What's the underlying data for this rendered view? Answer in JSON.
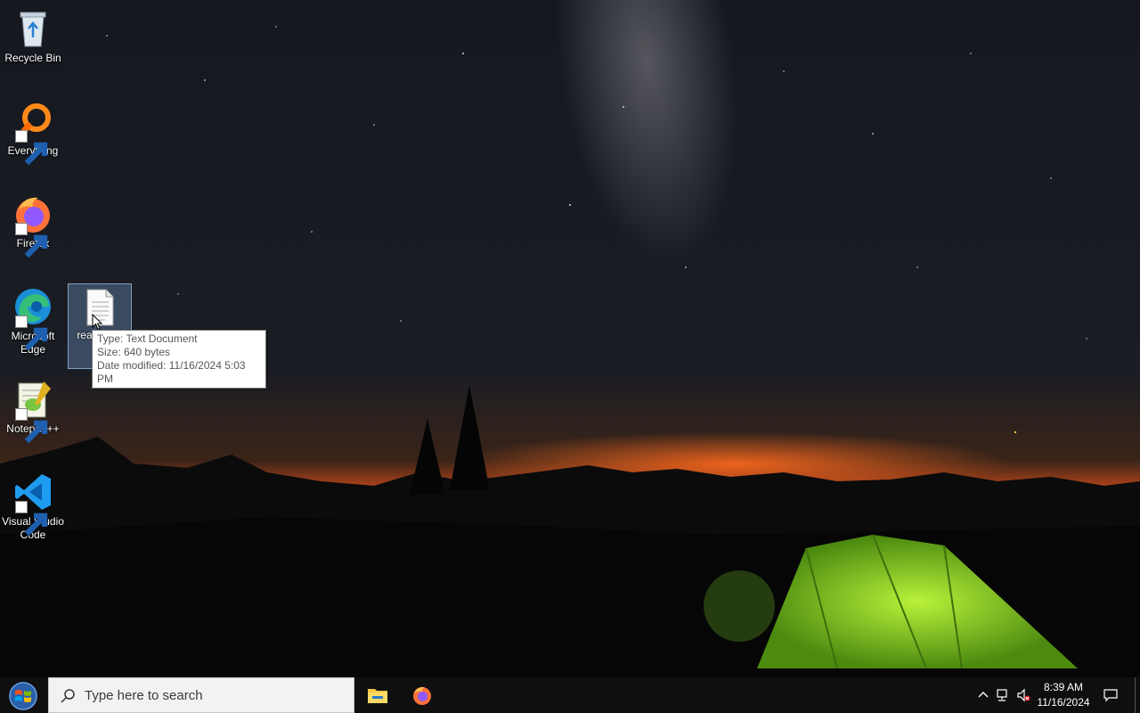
{
  "desktop": {
    "icons": [
      {
        "label": "Recycle Bin",
        "icon": "recycle-bin-icon"
      },
      {
        "label": "Everything",
        "icon": "everything-search-icon"
      },
      {
        "label": "Firefox",
        "icon": "firefox-icon"
      },
      {
        "label": "Microsoft Edge",
        "icon": "edge-icon"
      },
      {
        "label": "Notepad++",
        "icon": "notepadpp-icon"
      },
      {
        "label": "Visual Studio Code",
        "icon": "vscode-icon"
      }
    ],
    "selected_file": {
      "label": "rea (»o ¼",
      "icon": "text-document-icon"
    },
    "tooltip": {
      "type": "Type: Text Document",
      "size": "Size: 640 bytes",
      "modified": "Date modified: 11/16/2024 5:03 PM"
    }
  },
  "taskbar": {
    "search_placeholder": "Type here to search",
    "pinned": [
      {
        "name": "File Explorer",
        "icon": "file-explorer-icon"
      },
      {
        "name": "Firefox",
        "icon": "firefox-icon"
      }
    ],
    "tray": {
      "time": "8:39 AM",
      "date": "11/16/2024"
    }
  },
  "colors": {
    "taskbar_bg": "#0f0f10",
    "tooltip_border": "#767676",
    "tent_green": "#8fdc2a",
    "horizon_orange": "#d2501a"
  }
}
